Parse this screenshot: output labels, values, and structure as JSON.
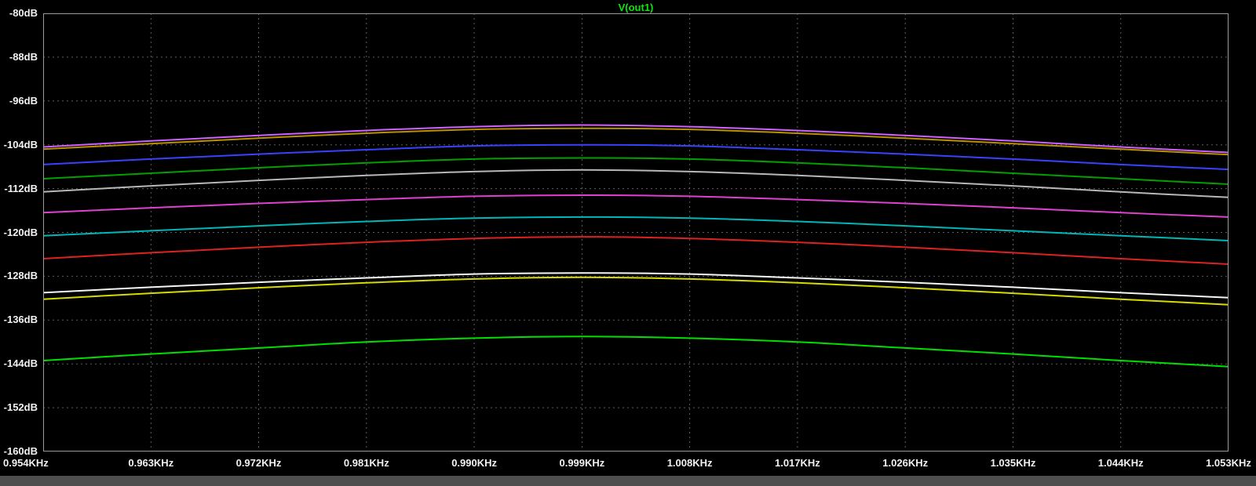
{
  "window": {
    "title": "V(out1)"
  },
  "colors": {
    "background": "#000000",
    "plot_background": "#000000",
    "frame": "#9a9a9a",
    "grid": "#5e5e5e",
    "label_text": "#f2f2f2",
    "title": "#0ce60c",
    "bottom_strip": "#4e4e4e"
  },
  "chart_data": {
    "type": "line",
    "title": "V(out1)",
    "xlabel": "",
    "ylabel": "",
    "x_unit": "KHz",
    "y_unit": "dB",
    "grid": "dashed",
    "legend_position": "none",
    "xlim": [
      0.954,
      1.053
    ],
    "ylim": [
      -160,
      -80
    ],
    "x_ticks": [
      "0.954KHz",
      "0.963KHz",
      "0.972KHz",
      "0.981KHz",
      "0.990KHz",
      "0.999KHz",
      "1.008KHz",
      "1.017KHz",
      "1.026KHz",
      "1.035KHz",
      "1.044KHz",
      "1.053KHz"
    ],
    "y_ticks": [
      "-80dB",
      "-88dB",
      "-96dB",
      "-104dB",
      "-112dB",
      "-120dB",
      "-128dB",
      "-136dB",
      "-144dB",
      "-152dB",
      "-160dB"
    ],
    "x_values": [
      0.954,
      0.963,
      0.972,
      0.981,
      0.99,
      0.999,
      1.008,
      1.017,
      1.026,
      1.035,
      1.044,
      1.053
    ],
    "series": [
      {
        "color": "#d060ff",
        "values": [
          -104.4,
          -103.3,
          -102.3,
          -101.4,
          -100.7,
          -100.4,
          -100.7,
          -101.4,
          -102.3,
          -103.3,
          -104.4,
          -105.4
        ]
      },
      {
        "color": "#b99000",
        "values": [
          -104.8,
          -103.8,
          -102.8,
          -101.9,
          -101.2,
          -101.0,
          -101.2,
          -101.9,
          -102.8,
          -103.8,
          -104.8,
          -105.8
        ]
      },
      {
        "color": "#3742ff",
        "values": [
          -107.6,
          -106.6,
          -105.7,
          -104.9,
          -104.2,
          -104.0,
          -104.2,
          -104.9,
          -105.7,
          -106.6,
          -107.6,
          -108.5
        ]
      },
      {
        "color": "#00a000",
        "values": [
          -110.2,
          -109.2,
          -108.2,
          -107.3,
          -106.6,
          -106.4,
          -106.6,
          -107.3,
          -108.2,
          -109.2,
          -110.2,
          -111.2
        ]
      },
      {
        "color": "#b8b8b8",
        "values": [
          -112.6,
          -111.5,
          -110.5,
          -109.6,
          -108.9,
          -108.6,
          -108.9,
          -109.6,
          -110.5,
          -111.5,
          -112.6,
          -113.6
        ]
      },
      {
        "color": "#e040d0",
        "values": [
          -116.4,
          -115.5,
          -114.7,
          -114.0,
          -113.4,
          -113.2,
          -113.4,
          -114.0,
          -114.7,
          -115.5,
          -116.4,
          -117.2
        ]
      },
      {
        "color": "#00b7b7",
        "values": [
          -120.6,
          -119.7,
          -118.8,
          -118.0,
          -117.4,
          -117.2,
          -117.4,
          -118.0,
          -118.8,
          -119.7,
          -120.6,
          -121.5
        ]
      },
      {
        "color": "#dd2222",
        "values": [
          -124.8,
          -123.7,
          -122.7,
          -121.8,
          -121.1,
          -120.8,
          -121.1,
          -121.8,
          -122.7,
          -123.7,
          -124.8,
          -125.8
        ]
      },
      {
        "color": "#f5f5f5",
        "values": [
          -131.0,
          -130.0,
          -129.1,
          -128.3,
          -127.6,
          -127.4,
          -127.6,
          -128.3,
          -129.1,
          -130.0,
          -131.0,
          -131.9
        ]
      },
      {
        "color": "#d9d900",
        "values": [
          -132.2,
          -131.1,
          -130.1,
          -129.2,
          -128.5,
          -128.2,
          -128.5,
          -129.2,
          -130.1,
          -131.1,
          -132.2,
          -133.2
        ]
      },
      {
        "color": "#00e000",
        "values": [
          -143.4,
          -142.2,
          -141.1,
          -140.0,
          -139.3,
          -139.0,
          -139.3,
          -140.0,
          -141.1,
          -142.2,
          -143.4,
          -144.5
        ]
      }
    ]
  }
}
